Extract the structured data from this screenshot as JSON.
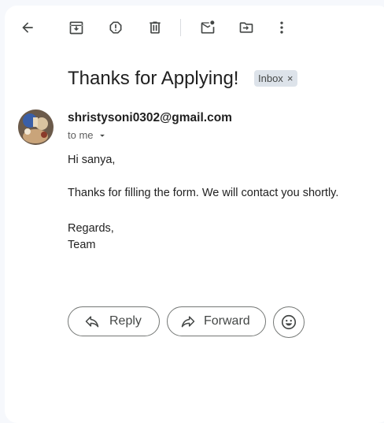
{
  "toolbar": {
    "icons": [
      "back-arrow-icon",
      "archive-icon",
      "report-spam-icon",
      "delete-icon",
      "mark-unread-icon",
      "move-to-icon",
      "more-options-icon"
    ]
  },
  "message": {
    "subject": "Thanks for Applying!",
    "label": "Inbox",
    "label_remove": "×",
    "sender": "shristysoni0302@gmail.com",
    "recipient": "to me",
    "body": {
      "greeting": "Hi sanya,",
      "line1": "Thanks for filling the form. We will contact you shortly.",
      "closing": "Regards,",
      "signature": "Team"
    }
  },
  "actions": {
    "reply_label": "Reply",
    "forward_label": "Forward"
  },
  "colors": {
    "page_bg": "#f6f8fc",
    "card_bg": "#ffffff",
    "chip_bg": "#dde3ea",
    "icon": "#444746"
  }
}
